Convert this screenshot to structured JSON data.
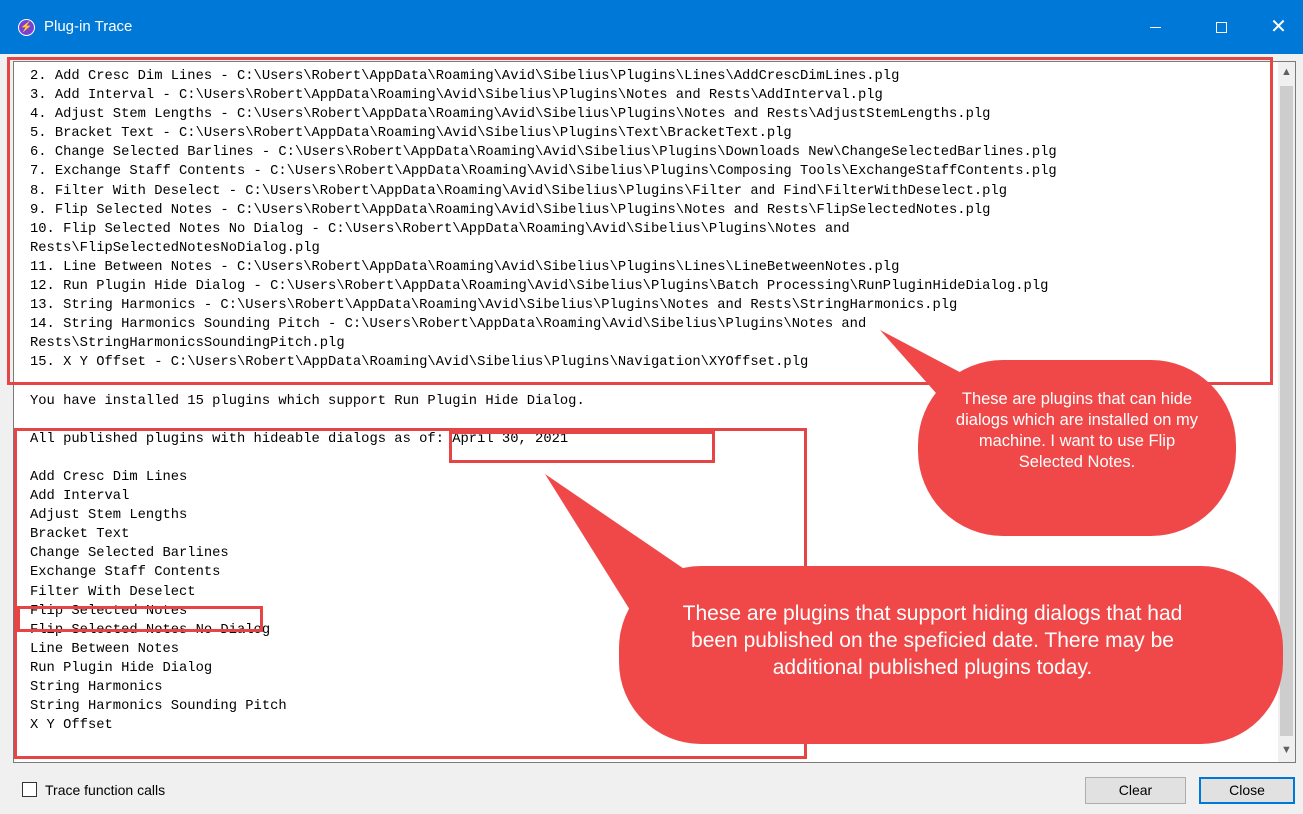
{
  "window": {
    "title": "Plug-in Trace",
    "icon": "plugin-app-icon",
    "controls": {
      "minimize": "minimize-icon",
      "maximize": "maximize-icon",
      "close": "close-icon"
    },
    "accent_color": "#0078d7"
  },
  "trace": {
    "installed_lines": [
      "2. Add Cresc Dim Lines - C:\\Users\\Robert\\AppData\\Roaming\\Avid\\Sibelius\\Plugins\\Lines\\AddCrescDimLines.plg",
      "3. Add Interval - C:\\Users\\Robert\\AppData\\Roaming\\Avid\\Sibelius\\Plugins\\Notes and Rests\\AddInterval.plg",
      "4. Adjust Stem Lengths - C:\\Users\\Robert\\AppData\\Roaming\\Avid\\Sibelius\\Plugins\\Notes and Rests\\AdjustStemLengths.plg",
      "5. Bracket Text - C:\\Users\\Robert\\AppData\\Roaming\\Avid\\Sibelius\\Plugins\\Text\\BracketText.plg",
      "6. Change Selected Barlines - C:\\Users\\Robert\\AppData\\Roaming\\Avid\\Sibelius\\Plugins\\Downloads New\\ChangeSelectedBarlines.plg",
      "7. Exchange Staff Contents - C:\\Users\\Robert\\AppData\\Roaming\\Avid\\Sibelius\\Plugins\\Composing Tools\\ExchangeStaffContents.plg",
      "8. Filter With Deselect - C:\\Users\\Robert\\AppData\\Roaming\\Avid\\Sibelius\\Plugins\\Filter and Find\\FilterWithDeselect.plg",
      "9. Flip Selected Notes - C:\\Users\\Robert\\AppData\\Roaming\\Avid\\Sibelius\\Plugins\\Notes and Rests\\FlipSelectedNotes.plg",
      "10. Flip Selected Notes No Dialog - C:\\Users\\Robert\\AppData\\Roaming\\Avid\\Sibelius\\Plugins\\Notes and",
      "Rests\\FlipSelectedNotesNoDialog.plg",
      "11. Line Between Notes - C:\\Users\\Robert\\AppData\\Roaming\\Avid\\Sibelius\\Plugins\\Lines\\LineBetweenNotes.plg",
      "12. Run Plugin Hide Dialog - C:\\Users\\Robert\\AppData\\Roaming\\Avid\\Sibelius\\Plugins\\Batch Processing\\RunPluginHideDialog.plg",
      "13. String Harmonics - C:\\Users\\Robert\\AppData\\Roaming\\Avid\\Sibelius\\Plugins\\Notes and Rests\\StringHarmonics.plg",
      "14. String Harmonics Sounding Pitch - C:\\Users\\Robert\\AppData\\Roaming\\Avid\\Sibelius\\Plugins\\Notes and",
      "Rests\\StringHarmonicsSoundingPitch.plg",
      "15. X Y Offset - C:\\Users\\Robert\\AppData\\Roaming\\Avid\\Sibelius\\Plugins\\Navigation\\XYOffset.plg"
    ],
    "installed_summary": "You have installed 15 plugins which support Run Plugin Hide Dialog.",
    "published_header": "All published plugins with hideable dialogs as of: April 30, 2021",
    "published_list": [
      "Add Cresc Dim Lines",
      "Add Interval",
      "Adjust Stem Lengths",
      "Bracket Text",
      "Change Selected Barlines",
      "Exchange Staff Contents",
      "Filter With Deselect",
      "Flip Selected Notes",
      "Flip Selected Notes No Dialog",
      "Line Between Notes",
      "Run Plugin Hide Dialog",
      "String Harmonics",
      "String Harmonics Sounding Pitch",
      "X Y Offset"
    ]
  },
  "annotations": {
    "color": "#f04848",
    "callout_installed": "These are plugins that can hide dialogs which are installed on my machine. I want to use Flip Selected Notes.",
    "callout_published": "These are plugins that support hiding dialogs that had been published on the speficied date. There may be additional published plugins today."
  },
  "footer": {
    "trace_checkbox_label": "Trace function calls",
    "trace_checked": false,
    "clear_label": "Clear",
    "close_label": "Close"
  }
}
